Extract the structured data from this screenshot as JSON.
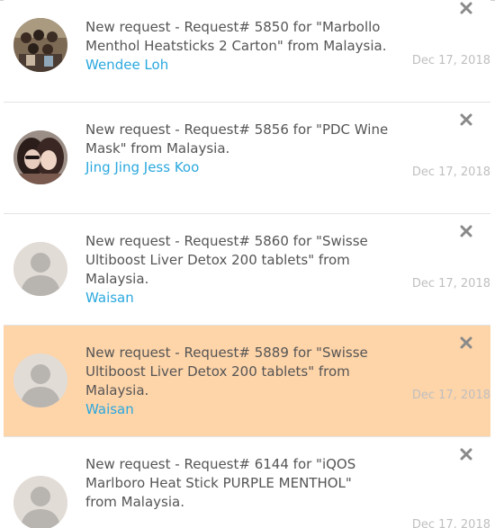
{
  "notifications": [
    {
      "message": "New request - Request# 5850 for \"Marbollo Menthol Heatsticks 2 Carton\" from Malaysia.",
      "author": "Wendee Loh",
      "date": "Dec 17, 2018",
      "avatar": "group-photo",
      "highlighted": false
    },
    {
      "message": "New request - Request# 5856 for \"PDC Wine Mask\" from Malaysia.",
      "author": "Jing Jing Jess Koo",
      "date": "Dec 17, 2018",
      "avatar": "two-women-photo",
      "highlighted": false
    },
    {
      "message": "New request - Request# 5860 for \"Swisse Ultiboost Liver Detox 200 tablets\" from Malaysia.",
      "author": "Waisan",
      "date": "Dec 17, 2018",
      "avatar": "default-user-icon",
      "highlighted": false
    },
    {
      "message": "New request - Request# 5889 for \"Swisse Ultiboost Liver Detox 200 tablets\" from Malaysia.",
      "author": "Waisan",
      "date": "Dec 17, 2018",
      "avatar": "default-user-icon",
      "highlighted": true
    },
    {
      "message": "New request - Request# 6144 for \"iQOS Marlboro Heat Stick PURPLE MENTHOL\" from Malaysia.",
      "author": "",
      "date": "Dec 17, 2018",
      "avatar": "default-user-icon",
      "highlighted": false
    }
  ],
  "colors": {
    "highlight": "#fed4a9",
    "author_link": "#2aa8de",
    "message_text": "#555555",
    "date_text": "#bfbfbf",
    "close_icon": "#8a8a8a"
  },
  "icons": {
    "close": "close-icon",
    "default_avatar": "user-icon"
  }
}
